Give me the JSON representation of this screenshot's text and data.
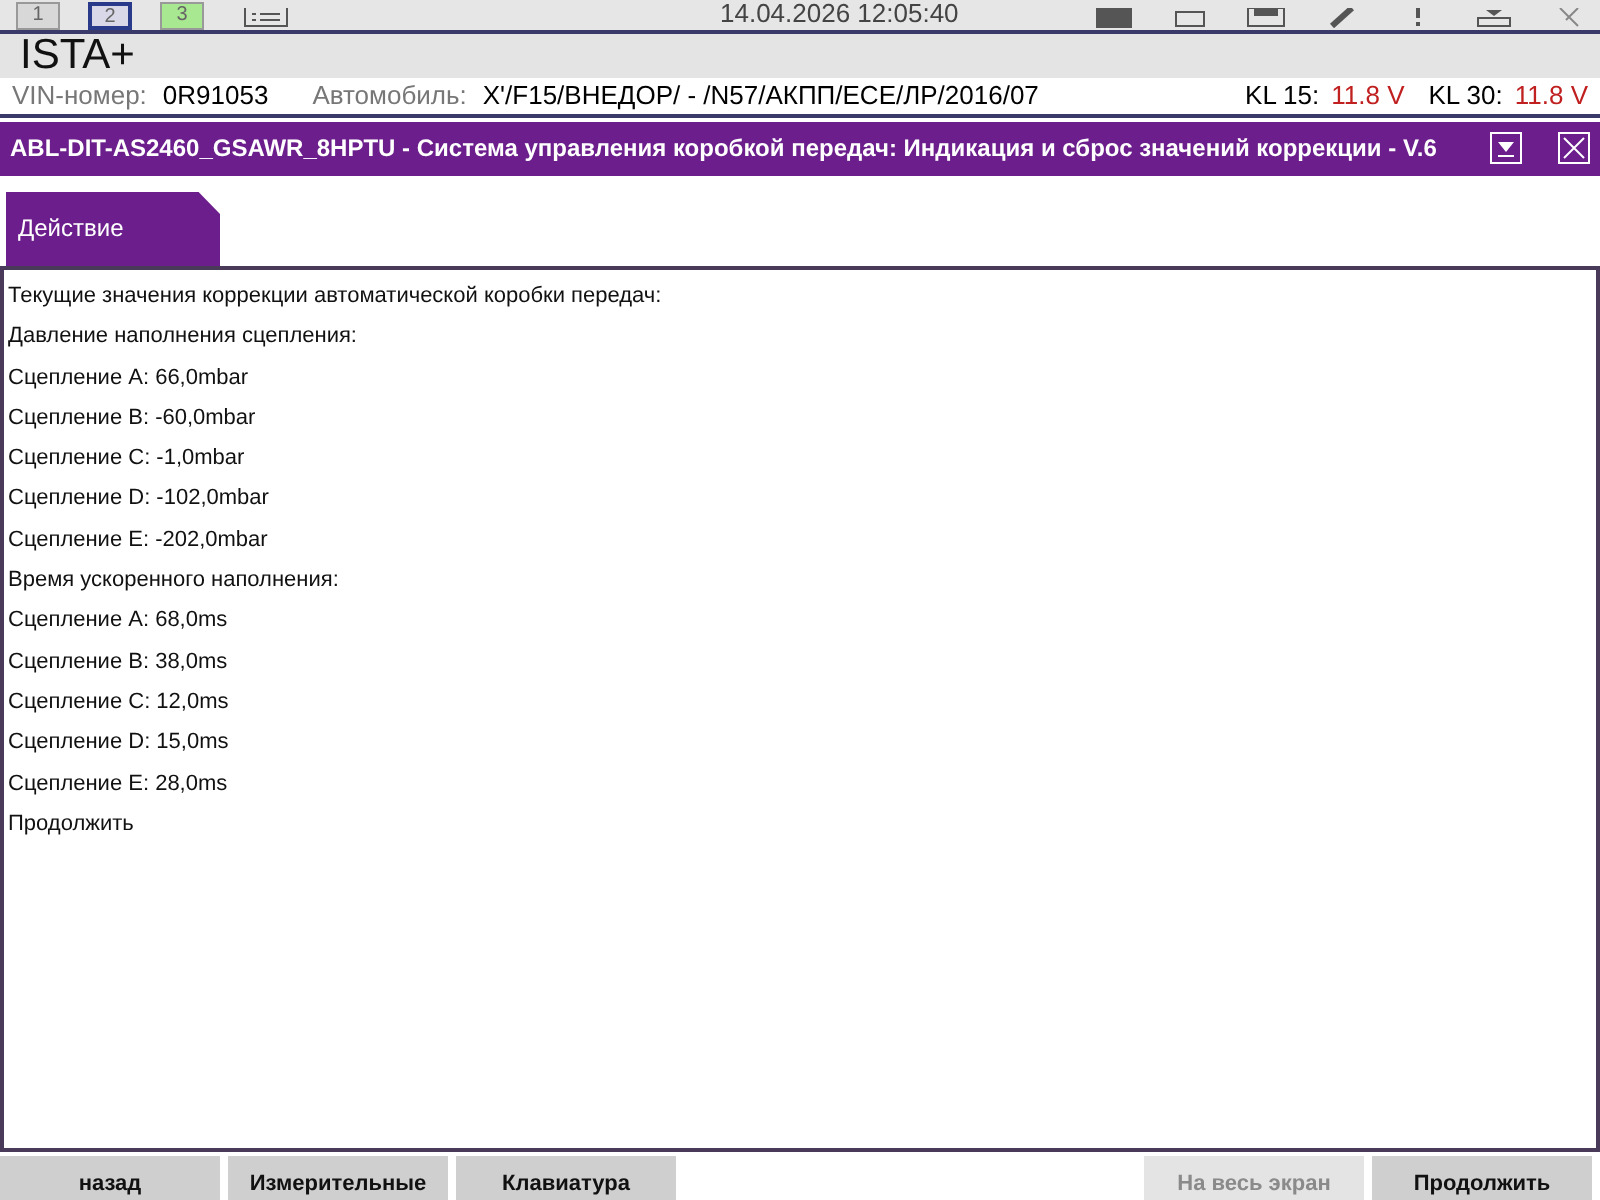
{
  "top_tabs": [
    {
      "label": "1",
      "selected": false,
      "color": "#d8d8d8"
    },
    {
      "label": "2",
      "selected": true,
      "color": "#d8d8e8"
    },
    {
      "label": "3",
      "selected": false,
      "color": "#a8e890"
    }
  ],
  "datetime": "14.04.2026 12:05:40",
  "app_title": "ISTA+",
  "vehicle": {
    "vin_label": "VIN-номер:",
    "vin": "0R91053",
    "car_label": "Автомобиль:",
    "car": "X'/F15/ВНЕДОР/ - /N57/АКПП/ECE/ЛР/2016/07",
    "kl15_label": "KL 15:",
    "kl15": "11.8 V",
    "kl30_label": "KL 30:",
    "kl30": "11.8 V"
  },
  "dialog": {
    "title": "ABL-DIT-AS2460_GSAWR_8HPTU - Система управления коробкой передач: Индикация и сброс значений коррекции - V.6",
    "tabs": [
      {
        "label": "Действие",
        "selected": true
      }
    ],
    "lines": [
      "Текущие значения коррекции автоматической коробки передач:",
      "Давление наполнения сцепления:",
      "Сцепление A: 66,0mbar",
      "Сцепление B: -60,0mbar",
      "Сцепление C: -1,0mbar",
      "Сцепление D: -102,0mbar",
      "Сцепление E: -202,0mbar",
      "Время ускоренного наполнения:",
      "Сцепление A: 68,0ms",
      "Сцепление B: 38,0ms",
      "Сцепление C: 12,0ms",
      "Сцепление D: 15,0ms",
      "Сцепление E: 28,0ms",
      "Продолжить"
    ]
  },
  "buttons_left": [
    {
      "label": "назад",
      "disabled": false
    },
    {
      "label": "Измерительные",
      "disabled": false
    },
    {
      "label": "Клавиатура",
      "disabled": false
    }
  ],
  "buttons_right": [
    {
      "label": "На весь экран",
      "disabled": true
    },
    {
      "label": "Продолжить",
      "disabled": false
    }
  ]
}
